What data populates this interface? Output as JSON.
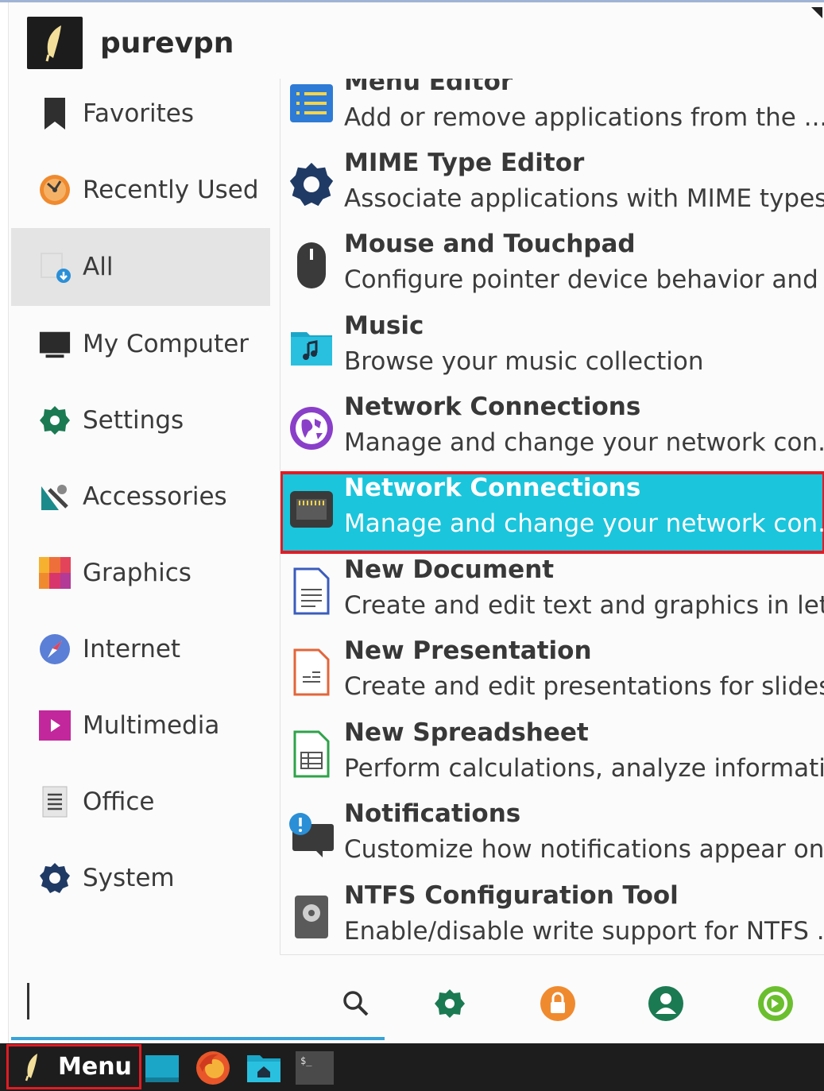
{
  "header": {
    "user_name": "purevpn"
  },
  "categories": [
    {
      "label": "Favorites",
      "icon": "bookmark-icon"
    },
    {
      "label": "Recently Used",
      "icon": "clock-icon"
    },
    {
      "label": "All",
      "icon": "all-apps-icon",
      "selected": true
    },
    {
      "label": "My Computer",
      "icon": "monitor-icon"
    },
    {
      "label": "Settings",
      "icon": "settings-gear-icon"
    },
    {
      "label": "Accessories",
      "icon": "accessories-icon"
    },
    {
      "label": "Graphics",
      "icon": "graphics-icon"
    },
    {
      "label": "Internet",
      "icon": "compass-icon"
    },
    {
      "label": "Multimedia",
      "icon": "multimedia-icon"
    },
    {
      "label": "Office",
      "icon": "document-icon"
    },
    {
      "label": "System",
      "icon": "gear-icon"
    }
  ],
  "apps": [
    {
      "name": "Menu Editor",
      "desc": "Add or remove applications from the ...",
      "icon": "menu-list-icon"
    },
    {
      "name": "MIME Type Editor",
      "desc": "Associate applications with MIME types",
      "icon": "gear-icon"
    },
    {
      "name": "Mouse and Touchpad",
      "desc": "Configure pointer device behavior and ...",
      "icon": "mouse-icon"
    },
    {
      "name": "Music",
      "desc": "Browse your music collection",
      "icon": "music-folder-icon"
    },
    {
      "name": "Network Connections",
      "desc": "Manage and change your network con...",
      "icon": "globe-icon"
    },
    {
      "name": "Network Connections",
      "desc": "Manage and change your network con...",
      "icon": "ethernet-icon",
      "highlighted": true
    },
    {
      "name": "New Document",
      "desc": "Create and edit text and graphics in lett...",
      "icon": "writer-document-icon"
    },
    {
      "name": "New Presentation",
      "desc": "Create and edit presentations for slides...",
      "icon": "impress-presentation-icon"
    },
    {
      "name": "New Spreadsheet",
      "desc": "Perform calculations, analyze informati...",
      "icon": "calc-spreadsheet-icon"
    },
    {
      "name": "Notifications",
      "desc": "Customize how notifications appear on...",
      "icon": "notification-icon"
    },
    {
      "name": "NTFS Configuration Tool",
      "desc": "Enable/disable write support for NTFS ...",
      "icon": "disk-icon"
    }
  ],
  "search": {
    "value": "",
    "placeholder": ""
  },
  "bottom_actions": [
    {
      "icon": "search-icon"
    },
    {
      "icon": "settings-icon"
    },
    {
      "icon": "lock-icon"
    },
    {
      "icon": "user-icon"
    },
    {
      "icon": "logout-icon"
    }
  ],
  "taskbar": {
    "menu_label": "Menu",
    "launchers": [
      "show-desktop-icon",
      "firefox-icon",
      "file-manager-icon",
      "terminal-icon"
    ]
  },
  "colors": {
    "highlight": "#1bc5dc",
    "annotation_red": "#e21b23",
    "accent_blue": "#36a3d9"
  }
}
